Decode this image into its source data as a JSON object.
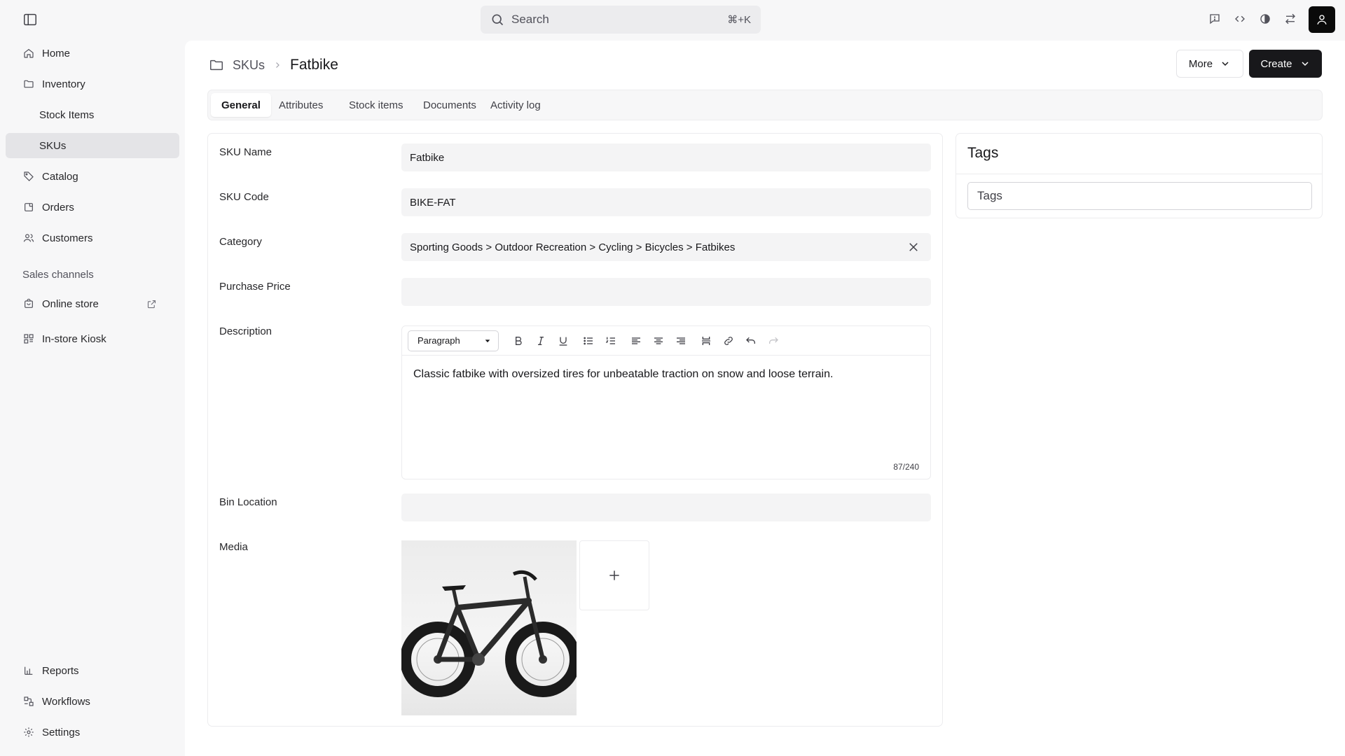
{
  "search": {
    "placeholder": "Search",
    "shortcut": "⌘+K"
  },
  "sidebar": {
    "items": [
      {
        "label": "Home"
      },
      {
        "label": "Inventory"
      },
      {
        "label": "Stock Items"
      },
      {
        "label": "SKUs"
      },
      {
        "label": "Catalog"
      },
      {
        "label": "Orders"
      },
      {
        "label": "Customers"
      }
    ],
    "sales_channels_label": "Sales channels",
    "channels": [
      {
        "label": "Online store"
      },
      {
        "label": "In-store Kiosk"
      }
    ],
    "bottom": [
      {
        "label": "Reports"
      },
      {
        "label": "Workflows"
      },
      {
        "label": "Settings"
      }
    ]
  },
  "breadcrumb": {
    "parent": "SKUs",
    "current": "Fatbike"
  },
  "actions": {
    "more_label": "More",
    "create_label": "Create"
  },
  "tabs": [
    {
      "label": "General"
    },
    {
      "label": "Attributes"
    },
    {
      "label": "Stock items"
    },
    {
      "label": "Documents"
    },
    {
      "label": "Activity log"
    }
  ],
  "form": {
    "sku_name": {
      "label": "SKU Name",
      "value": "Fatbike"
    },
    "sku_code": {
      "label": "SKU Code",
      "value": "BIKE-FAT"
    },
    "category": {
      "label": "Category",
      "value": "Sporting Goods > Outdoor Recreation > Cycling > Bicycles > Fatbikes"
    },
    "purchase_price": {
      "label": "Purchase Price",
      "value": ""
    },
    "description": {
      "label": "Description",
      "format": "Paragraph",
      "text": "Classic fatbike with oversized tires for unbeatable traction on snow and loose terrain.",
      "counter": "87/240"
    },
    "bin_location": {
      "label": "Bin Location",
      "value": ""
    },
    "media": {
      "label": "Media"
    }
  },
  "tags": {
    "title": "Tags",
    "placeholder": "Tags"
  }
}
